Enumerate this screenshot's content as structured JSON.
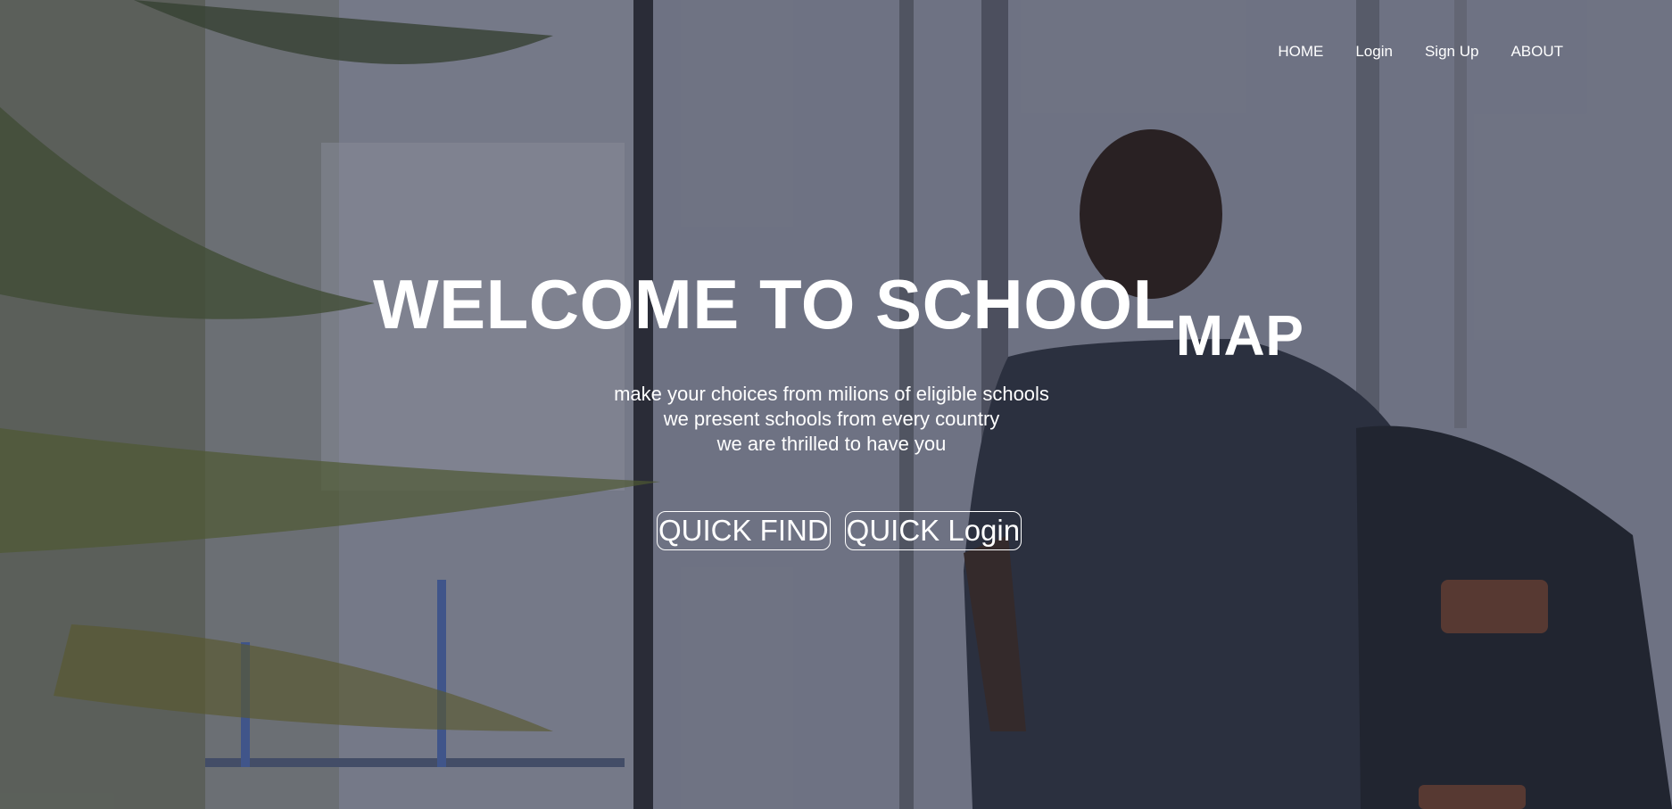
{
  "nav": {
    "items": [
      {
        "label": "HOME"
      },
      {
        "label": "Login"
      },
      {
        "label": "Sign Up"
      },
      {
        "label": "ABOUT"
      }
    ]
  },
  "hero": {
    "title_main": "WELCOME TO SCHOOL",
    "title_suffix": "MAP",
    "tagline_lines": [
      "make your choices from milions of eligible schools",
      "we present schools from every country",
      "we are thrilled to have you"
    ],
    "buttons": {
      "quick_find": "QUICK FIND",
      "quick_login": "QUICK Login"
    }
  },
  "colors": {
    "text": "#ffffff",
    "overlay": "#3a3f52"
  }
}
